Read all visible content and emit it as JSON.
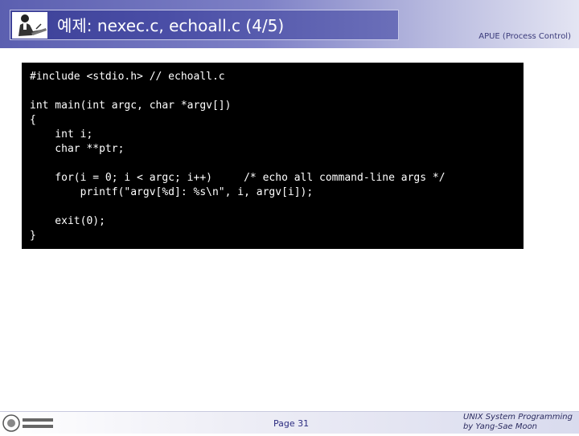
{
  "header": {
    "title": "예제: nexec.c, echoall.c (4/5)",
    "course": "APUE (Process Control)"
  },
  "code": {
    "lines": [
      "#include <stdio.h> // echoall.c",
      "int main(int argc, char *argv[])",
      "{",
      "    int i;",
      "    char **ptr;",
      "    for(i = 0; i < argc; i++)     /* echo all command-line args */",
      "        printf(\"argv[%d]: %s\\n\", i, argv[i]);",
      "    exit(0);",
      "}"
    ]
  },
  "footer": {
    "page": "Page 31",
    "course_line1": "UNIX System Programming",
    "course_line2": "by Yang-Sae Moon"
  },
  "icons": {
    "header_logo": "teacher-at-desk-icon",
    "footer_logo": "university-seal-icon"
  }
}
